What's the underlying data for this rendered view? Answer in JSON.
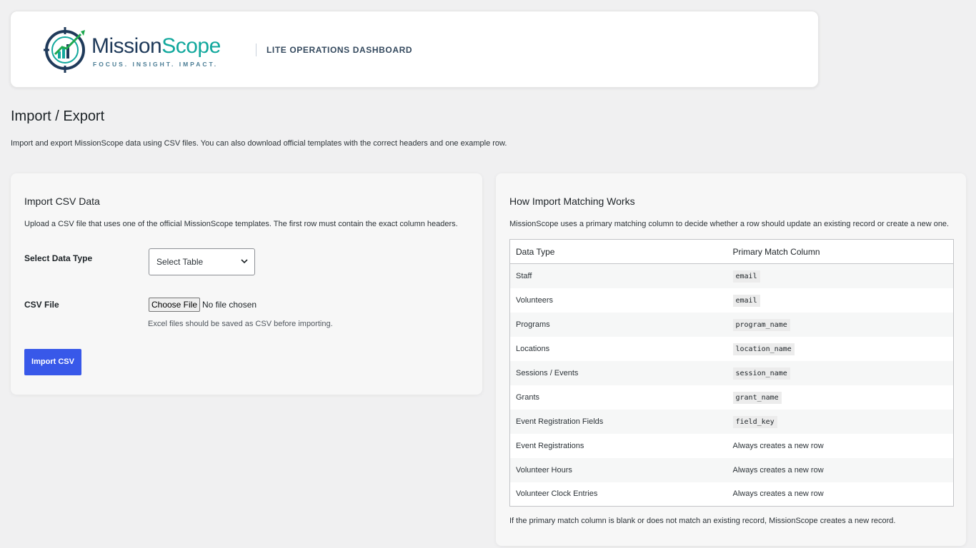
{
  "header": {
    "brand_name_part1": "Mission",
    "brand_name_part2": "Scope",
    "brand_tagline": "FOCUS. INSIGHT. IMPACT.",
    "subtitle": "LITE OPERATIONS DASHBOARD"
  },
  "page": {
    "title": "Import / Export",
    "description": "Import and export MissionScope data using CSV files. You can also download official templates with the correct headers and one example row."
  },
  "import_panel": {
    "title": "Import CSV Data",
    "description": "Upload a CSV file that uses one of the official MissionScope templates. The first row must contain the exact column headers.",
    "data_type_label": "Select Data Type",
    "data_type_value": "Select Table",
    "csv_file_label": "CSV File",
    "choose_file_label": "Choose File",
    "file_status": "No file chosen",
    "file_hint": "Excel files should be saved as CSV before importing.",
    "import_button": "Import CSV"
  },
  "matching_panel": {
    "title": "How Import Matching Works",
    "description": "MissionScope uses a primary matching column to decide whether a row should update an existing record or create a new one.",
    "columns": [
      "Data Type",
      "Primary Match Column"
    ],
    "rows": [
      {
        "type": "Staff",
        "match": "email",
        "code": true
      },
      {
        "type": "Volunteers",
        "match": "email",
        "code": true
      },
      {
        "type": "Programs",
        "match": "program_name",
        "code": true
      },
      {
        "type": "Locations",
        "match": "location_name",
        "code": true
      },
      {
        "type": "Sessions / Events",
        "match": "session_name",
        "code": true
      },
      {
        "type": "Grants",
        "match": "grant_name",
        "code": true
      },
      {
        "type": "Event Registration Fields",
        "match": "field_key",
        "code": true
      },
      {
        "type": "Event Registrations",
        "match": "Always creates a new row",
        "code": false
      },
      {
        "type": "Volunteer Hours",
        "match": "Always creates a new row",
        "code": false
      },
      {
        "type": "Volunteer Clock Entries",
        "match": "Always creates a new row",
        "code": false
      }
    ],
    "footnote": "If the primary match column is blank or does not match an existing record, MissionScope creates a new record."
  },
  "colors": {
    "primary_button": "#3858e9",
    "brand_navy": "#1f3a5a",
    "brand_teal": "#12a89d"
  }
}
